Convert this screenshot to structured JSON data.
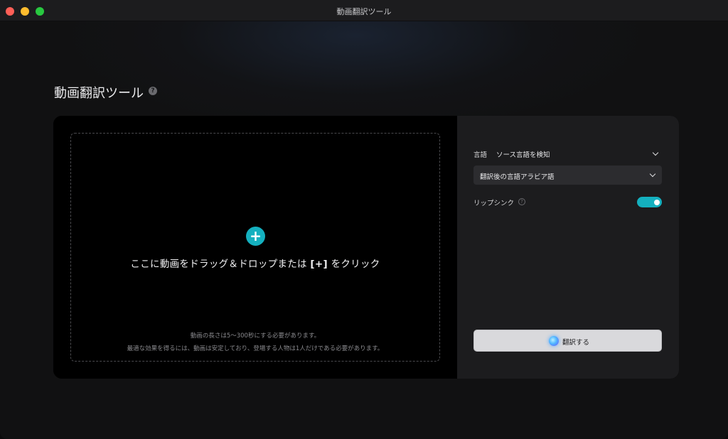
{
  "window": {
    "title": "動画翻訳ツール"
  },
  "page": {
    "title": "動画翻訳ツール",
    "help_icon": "?"
  },
  "upload": {
    "plus_symbol": "+",
    "drop_text_before": "ここに動画をドラッグ＆ドロップまたは ",
    "drop_text_bracket": "[+]",
    "drop_text_after": " をクリック",
    "note1": "動画の長さは5～300秒にする必要があります。",
    "note2": "最適な効果を得るには、動画は安定しており、登場する人物は1人だけである必要があります。"
  },
  "settings": {
    "language_label": "言語",
    "source_value": "ソース言語を検知",
    "target_value": "翻訳後の言語アラビア語",
    "lipsync_label": "リップシンク",
    "lipsync_help": "?",
    "lipsync_enabled": true,
    "translate_button": "翻訳する"
  },
  "colors": {
    "accent": "#14b0bf",
    "panel_bg": "#1c1c1e",
    "button_bg": "#d9d9dc"
  }
}
